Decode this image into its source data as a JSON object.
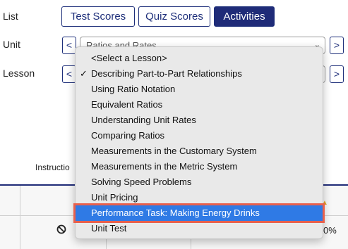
{
  "labels": {
    "list": "List",
    "unit": "Unit",
    "lesson": "Lesson"
  },
  "tabs": [
    {
      "label": "Test Scores",
      "active": false
    },
    {
      "label": "Quiz Scores",
      "active": false
    },
    {
      "label": "Activities",
      "active": true
    }
  ],
  "unit_select": {
    "value": "Ratios and Rates",
    "prev": "<",
    "next": ">",
    "chevron": "⌄"
  },
  "lesson_select": {
    "prev": "<",
    "next": ">",
    "chevron": "⌄"
  },
  "instructions_label": "Instructio",
  "table": {
    "status_icon": "no-entry-icon",
    "percent_text": "0%"
  },
  "dropdown": {
    "options": [
      {
        "label": "<Select a Lesson>",
        "checked": false,
        "selected": false
      },
      {
        "label": "Describing Part-to-Part Relationships",
        "checked": true,
        "selected": false
      },
      {
        "label": "Using Ratio Notation",
        "checked": false,
        "selected": false
      },
      {
        "label": "Equivalent Ratios",
        "checked": false,
        "selected": false
      },
      {
        "label": "Understanding Unit Rates",
        "checked": false,
        "selected": false
      },
      {
        "label": "Comparing Ratios",
        "checked": false,
        "selected": false
      },
      {
        "label": "Measurements in the Customary System",
        "checked": false,
        "selected": false
      },
      {
        "label": "Measurements in the Metric System",
        "checked": false,
        "selected": false
      },
      {
        "label": "Solving Speed Problems",
        "checked": false,
        "selected": false
      },
      {
        "label": "Unit Pricing",
        "checked": false,
        "selected": false
      },
      {
        "label": "Performance Task: Making Energy Drinks",
        "checked": false,
        "selected": true
      },
      {
        "label": "Unit Test",
        "checked": false,
        "selected": false
      }
    ],
    "check_glyph": "✓"
  },
  "colors": {
    "navy": "#1f2b78",
    "highlight": "#2f7ae5",
    "highlight_border": "#e8604c"
  }
}
